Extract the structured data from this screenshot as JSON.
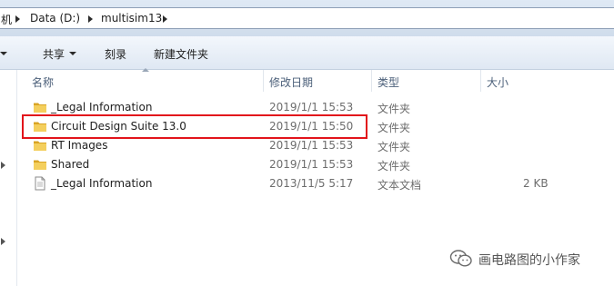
{
  "breadcrumb": {
    "partial": "机",
    "items": [
      "Data (D:)",
      "multisim13"
    ]
  },
  "toolbar": {
    "share_label": "共享",
    "burn_label": "刻录",
    "new_folder_label": "新建文件夹"
  },
  "columns": {
    "name": "名称",
    "modified": "修改日期",
    "type": "类型",
    "size": "大小"
  },
  "files": [
    {
      "name": "_Legal Information",
      "modified": "2019/1/1 15:53",
      "type": "文件夹",
      "size": "",
      "icon": "folder-icon"
    },
    {
      "name": "Circuit Design Suite 13.0",
      "modified": "2019/1/1 15:50",
      "type": "文件夹",
      "size": "",
      "icon": "folder-icon"
    },
    {
      "name": "RT Images",
      "modified": "2019/1/1 15:53",
      "type": "文件夹",
      "size": "",
      "icon": "folder-icon"
    },
    {
      "name": "Shared",
      "modified": "2019/1/1 15:53",
      "type": "文件夹",
      "size": "",
      "icon": "folder-icon"
    },
    {
      "name": "_Legal Information",
      "modified": "2013/11/5 5:17",
      "type": "文本文档",
      "size": "2 KB",
      "icon": "text-document-icon"
    }
  ],
  "highlight_color": "#e2141b",
  "watermark": {
    "text": "画电路图的小作家",
    "icon": "wechat-icon"
  }
}
